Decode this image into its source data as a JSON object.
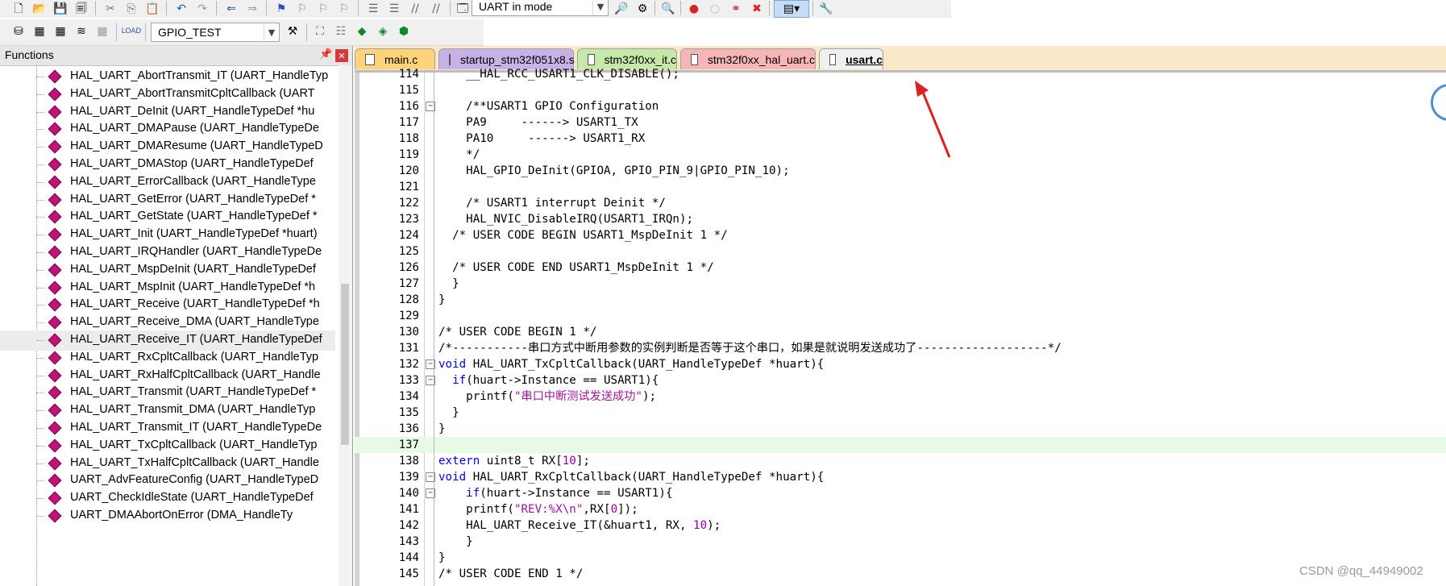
{
  "toolbar": {
    "mode_select": "UART in mode",
    "target_select": "GPIO_TEST"
  },
  "functions_panel": {
    "title": "Functions",
    "items": [
      "HAL_UART_AbortTransmit_IT (UART_HandleTyp",
      "HAL_UART_AbortTransmitCpltCallback (UART",
      "HAL_UART_DeInit (UART_HandleTypeDef *hu",
      "HAL_UART_DMAPause (UART_HandleTypeDe",
      "HAL_UART_DMAResume (UART_HandleTypeD",
      "HAL_UART_DMAStop (UART_HandleTypeDef",
      "HAL_UART_ErrorCallback (UART_HandleType",
      "HAL_UART_GetError (UART_HandleTypeDef *",
      "HAL_UART_GetState (UART_HandleTypeDef *",
      "HAL_UART_Init (UART_HandleTypeDef *huart)",
      "HAL_UART_IRQHandler (UART_HandleTypeDe",
      "HAL_UART_MspDeInit (UART_HandleTypeDef",
      "HAL_UART_MspInit (UART_HandleTypeDef *h",
      "HAL_UART_Receive (UART_HandleTypeDef *h",
      "HAL_UART_Receive_DMA (UART_HandleType",
      "HAL_UART_Receive_IT (UART_HandleTypeDef",
      "HAL_UART_RxCpltCallback (UART_HandleTyp",
      "HAL_UART_RxHalfCpltCallback (UART_Handle",
      "HAL_UART_Transmit (UART_HandleTypeDef *",
      "HAL_UART_Transmit_DMA (UART_HandleTyp",
      "HAL_UART_Transmit_IT (UART_HandleTypeDe",
      "HAL_UART_TxCpltCallback (UART_HandleTyp",
      "HAL_UART_TxHalfCpltCallback (UART_Handle",
      "UART_AdvFeatureConfig (UART_HandleTypeD",
      "UART_CheckIdleState (UART_HandleTypeDef",
      "UART_DMAAbortOnError (DMA_HandleTy"
    ],
    "selected_index": 15
  },
  "tabs": [
    {
      "label": "main.c",
      "color": "#ffd37a"
    },
    {
      "label": "startup_stm32f051x8.s",
      "color": "#c7b2e8"
    },
    {
      "label": "stm32f0xx_it.c",
      "color": "#c6e8a8"
    },
    {
      "label": "stm32f0xx_hal_uart.c",
      "color": "#f6b6b6"
    },
    {
      "label": "usart.c",
      "color": "#f0f0f0",
      "active": true
    }
  ],
  "code_lines": [
    {
      "n": "114",
      "t": "    __HAL_RCC_USART1_CLK_DISABLE();"
    },
    {
      "n": "115",
      "t": ""
    },
    {
      "n": "116",
      "t": "    /**USART1 GPIO Configuration",
      "fold": "−",
      "c": "cmt"
    },
    {
      "n": "117",
      "t": "    PA9     ------> USART1_TX",
      "c": "cmt"
    },
    {
      "n": "118",
      "t": "    PA10     ------> USART1_RX",
      "c": "cmt"
    },
    {
      "n": "119",
      "t": "    */",
      "c": "cmt"
    },
    {
      "n": "120",
      "t": "    HAL_GPIO_DeInit(GPIOA, GPIO_PIN_9|GPIO_PIN_10);"
    },
    {
      "n": "121",
      "t": ""
    },
    {
      "n": "122",
      "t": "    /* USART1 interrupt Deinit */",
      "c": "cmt"
    },
    {
      "n": "123",
      "t": "    HAL_NVIC_DisableIRQ(USART1_IRQn);"
    },
    {
      "n": "124",
      "t": "  /* USER CODE BEGIN USART1_MspDeInit 1 */",
      "c": "cmt"
    },
    {
      "n": "125",
      "t": ""
    },
    {
      "n": "126",
      "t": "  /* USER CODE END USART1_MspDeInit 1 */",
      "c": "cmt"
    },
    {
      "n": "127",
      "t": "  }"
    },
    {
      "n": "128",
      "t": "}"
    },
    {
      "n": "129",
      "t": ""
    },
    {
      "n": "130",
      "t": "/* USER CODE BEGIN 1 */",
      "c": "cmt"
    },
    {
      "n": "131",
      "t": "/*-----------串口方式中断用参数的实例判断是否等于这个串口，如果是就说明发送成功了-------------------*/",
      "c": "cmt"
    },
    {
      "n": "132",
      "t": "void HAL_UART_TxCpltCallback(UART_HandleTypeDef *huart){",
      "fold": "−"
    },
    {
      "n": "133",
      "t": "  if(huart->Instance == USART1){",
      "fold": "−"
    },
    {
      "n": "134",
      "t": "    printf(\"串口中断测试发送成功\");"
    },
    {
      "n": "135",
      "t": "  }"
    },
    {
      "n": "136",
      "t": "}"
    },
    {
      "n": "137",
      "t": "",
      "hl": true
    },
    {
      "n": "138",
      "t": "extern uint8_t RX[10];"
    },
    {
      "n": "139",
      "t": "void HAL_UART_RxCpltCallback(UART_HandleTypeDef *huart){",
      "fold": "−"
    },
    {
      "n": "140",
      "t": "    if(huart->Instance == USART1){",
      "fold": "−"
    },
    {
      "n": "141",
      "t": "    printf(\"REV:%X\\n\",RX[0]);"
    },
    {
      "n": "142",
      "t": "    HAL_UART_Receive_IT(&huart1, RX, 10);"
    },
    {
      "n": "143",
      "t": "    }"
    },
    {
      "n": "144",
      "t": "}"
    },
    {
      "n": "145",
      "t": "/* USER CODE END 1 */",
      "c": "cmt"
    }
  ],
  "watermark": "CSDN @qq_44949002",
  "colors": {
    "accent_arrow": "#e02020",
    "active_line": "#e6fae6",
    "comment": "#119911",
    "keyword": "#0000ee",
    "string": "#a0149b"
  }
}
